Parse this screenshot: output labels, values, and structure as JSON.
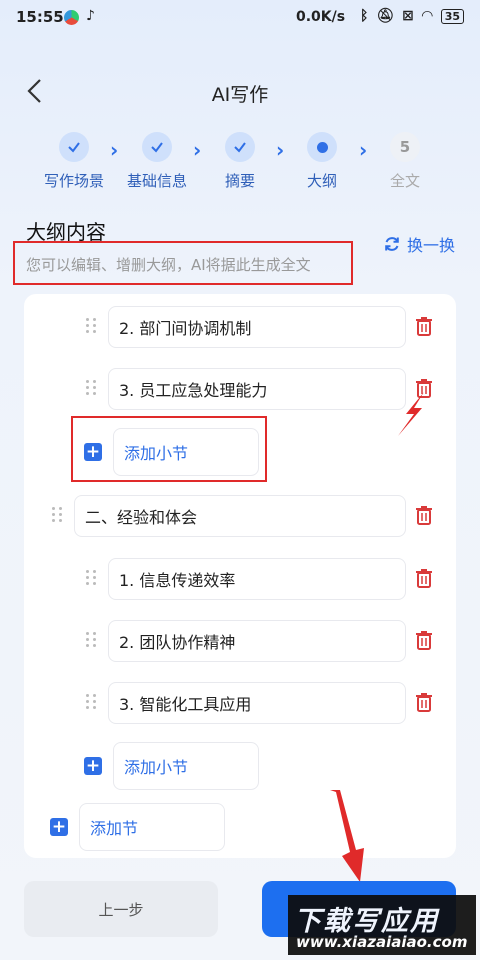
{
  "status_bar": {
    "time": "15:55",
    "net_speed": "0.0K/s",
    "battery": "35"
  },
  "header": {
    "title": "AI写作"
  },
  "steps": [
    {
      "label": "写作场景",
      "state": "done",
      "num": ""
    },
    {
      "label": "基础信息",
      "state": "done",
      "num": ""
    },
    {
      "label": "摘要",
      "state": "done",
      "num": ""
    },
    {
      "label": "大纲",
      "state": "active",
      "num": ""
    },
    {
      "label": "全文",
      "state": "todo",
      "num": "5"
    }
  ],
  "outline": {
    "title": "大纲内容",
    "hint": "您可以编辑、增删大纲，AI将据此生成全文",
    "refresh_label": "换一换",
    "items": {
      "i1": "2. 部门间协调机制",
      "i2": "3. 员工应急处理能力",
      "add_sub_1": "添加小节",
      "sec2": "二、经验和体会",
      "i4": "1. 信息传递效率",
      "i5": "2. 团队协作精神",
      "i6": "3. 智能化工具应用",
      "add_sub_2": "添加小节",
      "add_section": "添加节"
    }
  },
  "bottom": {
    "prev_label": "上一步"
  },
  "watermark": {
    "main": "下载写应用",
    "sub": "www.xiazaiaiao.com"
  },
  "colors": {
    "accent": "#2f6fe6",
    "delete": "#d93a3a",
    "annotation": "#e02a2a"
  }
}
